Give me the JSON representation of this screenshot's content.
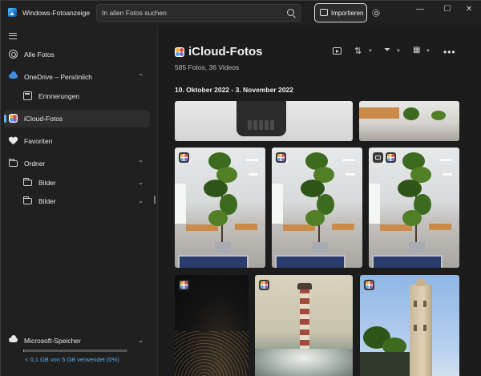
{
  "window": {
    "app_title": "Windows-Fotoanzeige",
    "search_placeholder": "In allen Fotos suchen",
    "import_label": "Importieren",
    "controls": {
      "minimize": "—",
      "maximize": "☐",
      "close": "✕"
    }
  },
  "sidebar": {
    "items": [
      {
        "label": "Alle Fotos",
        "icon": "photos-icon"
      },
      {
        "label": "OneDrive – Persönlich",
        "icon": "onedrive-cloud-icon",
        "expanded": true
      },
      {
        "label": "Erinnerungen",
        "icon": "memories-icon"
      },
      {
        "label": "iCloud-Fotos",
        "icon": "icloud-icon",
        "active": true
      },
      {
        "label": "Favoriten",
        "icon": "heart-icon"
      },
      {
        "label": "Ordner",
        "icon": "folder-icon",
        "expanded": true
      },
      {
        "label": "Bilder",
        "icon": "folder-icon"
      },
      {
        "label": "Bilder",
        "icon": "folder-icon"
      }
    ],
    "storage": {
      "label": "Microsoft-Speicher",
      "usage_text": "< 0,1 GB von 5 GB verwendet (0%)",
      "usage_fraction": 0.01
    }
  },
  "main": {
    "title": "iCloud-Fotos",
    "subtitle": "585 Fotos, 36 Videos",
    "date_range": "10. Oktober 2022 - 3. November 2022",
    "toolbar": {
      "more": "•••"
    }
  },
  "colors": {
    "accent": "#60b8f0",
    "storage_link": "#5aaef0",
    "background": "#202020"
  }
}
